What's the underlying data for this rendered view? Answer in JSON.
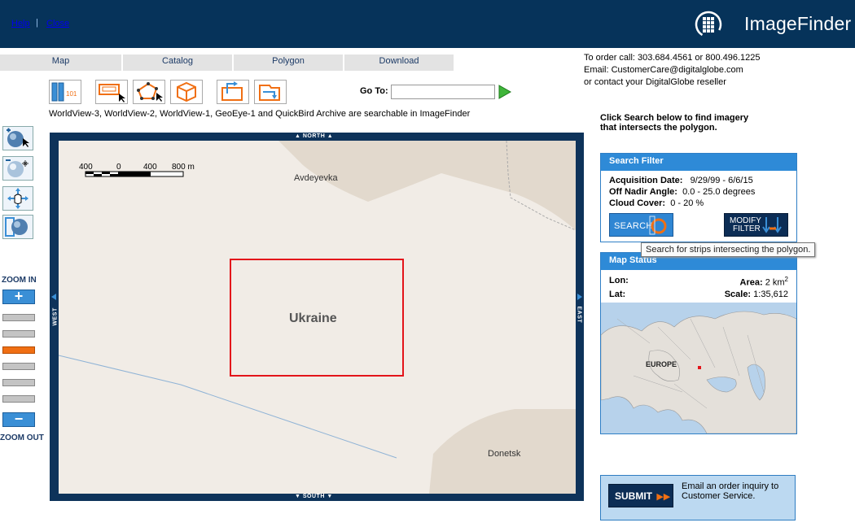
{
  "header": {
    "help_label": "Help",
    "separator": "|",
    "close_label": "Close",
    "app_title": "ImageFinder",
    "background_color": "#06335a"
  },
  "tabs": [
    {
      "label": "Map"
    },
    {
      "label": "Catalog"
    },
    {
      "label": "Polygon"
    },
    {
      "label": "Download"
    }
  ],
  "order_info": {
    "line1": "To order call: 303.684.4561 or 800.496.1225",
    "line2": "Email: CustomerCare@digitalglobe.com",
    "line3": "or contact your DigitalGlobe reseller"
  },
  "toolbar": {
    "tools": [
      "kml-ruler-icon",
      "rectangle-select-icon",
      "polygon-draw-icon",
      "box-3d-icon",
      "upload-shape-icon",
      "export-shape-icon"
    ],
    "goto_label": "Go To:",
    "goto_value": "",
    "goto_go_icon": "play-arrow-icon"
  },
  "archive_note": "WorldView-3, WorldView-2, WorldView-1, GeoEye-1 and QuickBird Archive are searchable in ImageFinder",
  "left_tools": {
    "icons": [
      "zoom-globe-icon",
      "zoom-out-globe-icon",
      "pan-hand-icon",
      "full-extent-icon"
    ],
    "zoom_in_label": "ZOOM IN",
    "zoom_out_label": "ZOOM OUT",
    "zoom_in_symbol": "+",
    "zoom_out_symbol": "−",
    "zoom_level_active": 3,
    "zoom_levels": 6,
    "accent_color": "#f06f13"
  },
  "map": {
    "north": "NORTH",
    "south": "SOUTH",
    "west": "WEST",
    "east": "EAST",
    "scale_ticks": [
      "400",
      "0",
      "400",
      "800 m"
    ],
    "labels": {
      "avdeyevka": "Avdeyevka",
      "ukraine": "Ukraine",
      "donetsk": "Donetsk"
    },
    "polygon_color": "#e3141a"
  },
  "right_panel": {
    "instructions_line1": "Click Search below to find imagery",
    "instructions_line2": "that intersects the polygon.",
    "search_filter": {
      "title": "Search Filter",
      "acq_label": "Acquisition Date:",
      "acq_value": "9/29/99 - 6/6/15",
      "off_nadir_label": "Off Nadir Angle:",
      "off_nadir_value": "0.0 - 25.0 degrees",
      "cloud_label": "Cloud Cover:",
      "cloud_value": "0 - 20 %",
      "search_button": "SEARCH",
      "modify_line1": "MODIFY",
      "modify_line2": "FILTER",
      "tooltip": "Search for strips intersecting the polygon."
    },
    "map_status": {
      "title": "Map Status",
      "lon_label": "Lon:",
      "lon_value": "",
      "lat_label": "Lat:",
      "lat_value": "",
      "area_label": "Area:",
      "area_value": "2 km",
      "area_exp": "2",
      "scale_label": "Scale:",
      "scale_value": "1:35,612",
      "minimap_label": "EUROPE"
    },
    "submit": {
      "button": "SUBMIT",
      "text_line1": "Email an order inquiry to",
      "text_line2": "Customer Service."
    }
  }
}
